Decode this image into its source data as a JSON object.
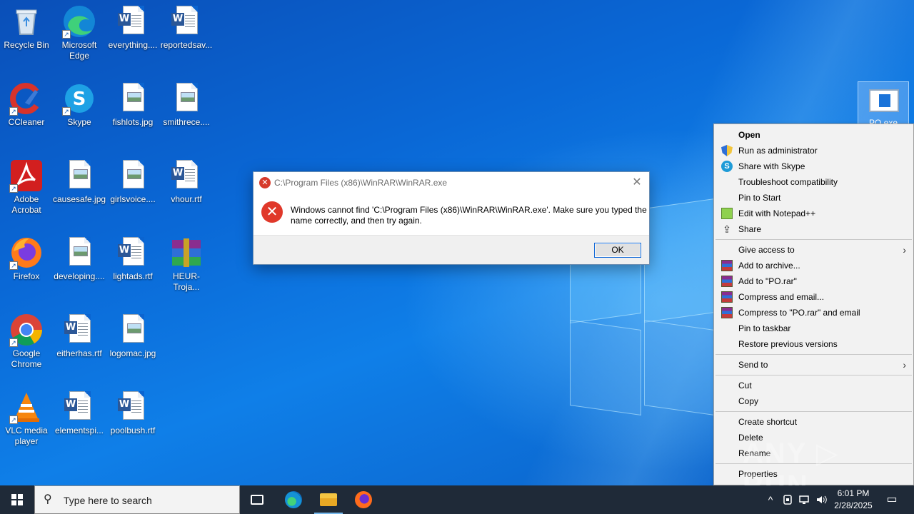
{
  "desktop": {
    "icons": [
      {
        "label": "Recycle Bin",
        "kind": "recycle-bin-icon"
      },
      {
        "label": "Microsoft Edge",
        "kind": "edge-icon"
      },
      {
        "label": "everything....",
        "kind": "word-doc-icon"
      },
      {
        "label": "reportedsav...",
        "kind": "word-doc-icon"
      },
      {
        "label": "CCleaner",
        "kind": "ccleaner-icon"
      },
      {
        "label": "Skype",
        "kind": "skype-icon"
      },
      {
        "label": "fishlots.jpg",
        "kind": "image-file-icon"
      },
      {
        "label": "smithrece....",
        "kind": "image-file-icon"
      },
      {
        "label": "Adobe Acrobat",
        "kind": "acrobat-icon"
      },
      {
        "label": "causesafe.jpg",
        "kind": "image-file-icon"
      },
      {
        "label": "girlsvoice....",
        "kind": "image-file-icon"
      },
      {
        "label": "vhour.rtf",
        "kind": "word-doc-icon"
      },
      {
        "label": "Firefox",
        "kind": "firefox-icon"
      },
      {
        "label": "developing....",
        "kind": "image-file-icon"
      },
      {
        "label": "lightads.rtf",
        "kind": "word-doc-icon"
      },
      {
        "label": "HEUR-Troja...",
        "kind": "winrar-icon"
      },
      {
        "label": "Google Chrome",
        "kind": "chrome-icon"
      },
      {
        "label": "eitherhas.rtf",
        "kind": "word-doc-icon"
      },
      {
        "label": "logomac.jpg",
        "kind": "image-file-icon"
      },
      {
        "label": "VLC media player",
        "kind": "vlc-icon"
      },
      {
        "label": "elementspi...",
        "kind": "word-doc-icon"
      },
      {
        "label": "poolbush.rtf",
        "kind": "word-doc-icon"
      }
    ],
    "selected_icon": {
      "label": "PO.exe"
    }
  },
  "dialog": {
    "title": "C:\\Program Files (x86)\\WinRAR\\WinRAR.exe",
    "message": "Windows cannot find 'C:\\Program Files (x86)\\WinRAR\\WinRAR.exe'. Make sure you typed the name correctly, and then try again.",
    "ok_label": "OK",
    "close_glyph": "✕",
    "error_glyph": "✕"
  },
  "context_menu": {
    "items": [
      {
        "label": "Open",
        "bold": true
      },
      {
        "label": "Run as administrator",
        "icon": "uac-shield-icon"
      },
      {
        "label": "Share with Skype",
        "icon": "skype-icon"
      },
      {
        "label": "Troubleshoot compatibility"
      },
      {
        "label": "Pin to Start"
      },
      {
        "label": "Edit with Notepad++",
        "icon": "notepadpp-icon"
      },
      {
        "label": "Share",
        "icon": "share-icon"
      },
      {
        "separator": true
      },
      {
        "label": "Give access to",
        "submenu": true
      },
      {
        "label": "Add to archive...",
        "icon": "winrar-icon"
      },
      {
        "label": "Add to \"PO.rar\"",
        "icon": "winrar-icon"
      },
      {
        "label": "Compress and email...",
        "icon": "winrar-icon"
      },
      {
        "label": "Compress to \"PO.rar\" and email",
        "icon": "winrar-icon"
      },
      {
        "label": "Pin to taskbar"
      },
      {
        "label": "Restore previous versions"
      },
      {
        "separator": true
      },
      {
        "label": "Send to",
        "submenu": true
      },
      {
        "separator": true
      },
      {
        "label": "Cut"
      },
      {
        "label": "Copy"
      },
      {
        "separator": true
      },
      {
        "label": "Create shortcut"
      },
      {
        "label": "Delete"
      },
      {
        "label": "Rename"
      },
      {
        "separator": true
      },
      {
        "label": "Properties"
      }
    ],
    "submenu_arrow": "›"
  },
  "watermark": "ANY ▷ RUN",
  "taskbar": {
    "search_placeholder": "Type here to search",
    "search_glyph": "⚲",
    "pinned": [
      {
        "name": "task-view-icon"
      },
      {
        "name": "edge-icon"
      },
      {
        "name": "file-explorer-icon"
      },
      {
        "name": "firefox-icon"
      }
    ],
    "tray": {
      "chevron": "^",
      "clock_time": "6:01 PM",
      "clock_date": "2/28/2025",
      "notification_glyph": "▭"
    }
  },
  "colors": {
    "taskbar_bg": "#1f2a38",
    "desktop_accent": "#0a68d6",
    "error_red": "#e0382a",
    "menu_bg": "#f2f2f2"
  }
}
